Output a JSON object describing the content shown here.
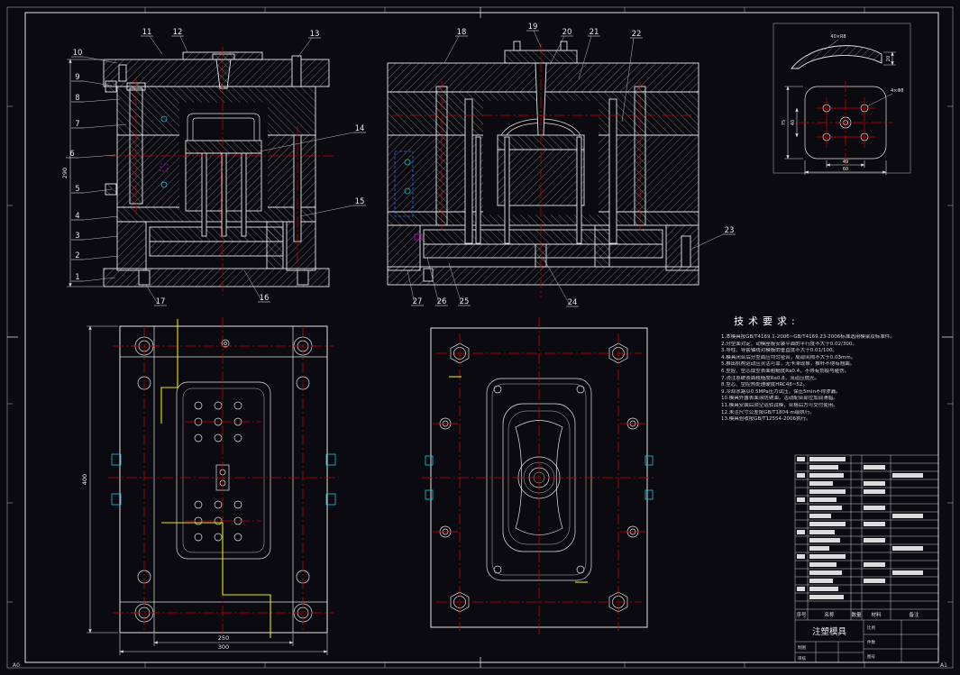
{
  "page": {
    "corner_left": "A0",
    "corner_right": "A1"
  },
  "callouts_left": [
    "1",
    "2",
    "3",
    "4",
    "5",
    "6",
    "7",
    "8",
    "9",
    "10",
    "11",
    "12",
    "13",
    "14",
    "15",
    "16",
    "17"
  ],
  "callouts_right": [
    "18",
    "19",
    "20",
    "21",
    "22",
    "23",
    "24",
    "25",
    "26",
    "27"
  ],
  "dims": {
    "left_height": "290",
    "plan_height": "400",
    "plan_w1": "250",
    "plan_w2": "300",
    "detail_top": "40×R8",
    "detail_side": "20",
    "detail_h1": "75",
    "detail_h2": "40",
    "detail_w1": "49",
    "detail_w2": "60",
    "detail_holes": "4×Φ8"
  },
  "tech": {
    "title": "技术要求:",
    "lines": [
      "1.本模具按GB/T4169.1-2006~GB/T4169.23-2006标准选用模架及标准件。",
      "2.分型面对定、动模座板安装平面的平行度不大于0.02/300。",
      "3.导柱、导套轴线对模板的垂直度不大于0.01/100。",
      "4.模具闭合后分型面应均匀密合，局部间隙不大于0.03mm。",
      "5.推出机构运动应灵活可靠，无卡滞现象，推杆不得有翘曲。",
      "6.型腔、型芯成型表面粗糙度Ra0.4，不得有划痕与碰伤。",
      "7.浇注系统表面粗糙度Ra0.8，流道应抛光。",
      "8.型芯、型腔热处理硬度HRC48~52。",
      "9.冷却水路以0.5MPa压力试压，保压5min不得渗漏。",
      "10.模具外露表面涂防锈油，活动配合部位加润滑脂。",
      "11.模具安装后须空运转试模，合格后方可交付使用。",
      "12.未注尺寸公差按GB/T1804-m级执行。",
      "13.模具验收按GB/T12554-2006执行。"
    ]
  },
  "bom": {
    "headers": [
      "序号",
      "名称",
      "数量",
      "材料",
      "备注"
    ]
  },
  "title_block": {
    "title": "注塑模具",
    "labels": [
      "制图",
      "审核",
      "比例",
      "件数",
      "图号"
    ]
  }
}
